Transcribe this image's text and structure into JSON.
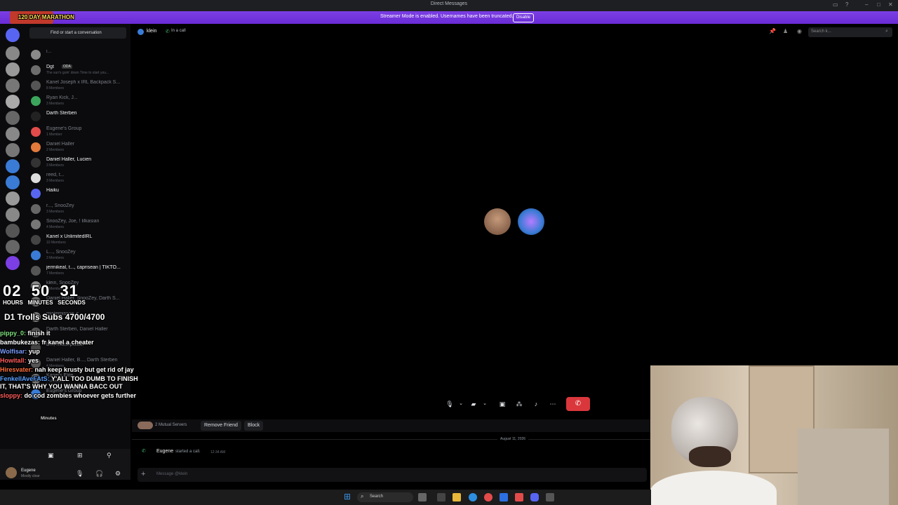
{
  "window": {
    "title": "Direct Messages"
  },
  "banner": {
    "message": "Streamer Mode is enabled. Usernames have been truncated.",
    "button": "Disable"
  },
  "dm_search": {
    "placeholder": "Find or start a conversation"
  },
  "dms": [
    {
      "name": "i...",
      "sub": "",
      "color": "#8a8a8a"
    },
    {
      "name": "Dgt",
      "tag": "ODA",
      "sub": "The sun's goin' down Time to start you...",
      "color": "#6d6d6d",
      "highlight": true
    },
    {
      "name": "Kanel Joseph x IRL Backpack S...",
      "sub": "8 Members",
      "color": "#555"
    },
    {
      "name": "Ryan Kick, J...",
      "sub": "3 Members",
      "color": "#3ba55c"
    },
    {
      "name": "Darth Sterben",
      "sub": "",
      "color": "#222",
      "highlight": true
    },
    {
      "name": "Eugene's Group",
      "sub": "1 Member",
      "color": "#e34b4b"
    },
    {
      "name": "Daniel Haller",
      "sub": "2 Members",
      "color": "#e3793b"
    },
    {
      "name": "Daniel Haller, Lucien",
      "sub": "3 Members",
      "color": "#333",
      "highlight": true
    },
    {
      "name": "reed, t...",
      "sub": "3 Members",
      "color": "#ddd"
    },
    {
      "name": "Haiku",
      "sub": "",
      "color": "#5865f2",
      "highlight": true
    },
    {
      "name": "r..., SnooZey",
      "sub": "3 Members",
      "color": "#666"
    },
    {
      "name": "SnooZey, Joe, ! lilkasian",
      "sub": "4 Members",
      "color": "#777"
    },
    {
      "name": "Kanel x UnlimitedIRL",
      "sub": "10 Members",
      "color": "#444",
      "highlight": true
    },
    {
      "name": "L..., SnooZey",
      "sub": "3 Members",
      "color": "#3a7bd5"
    },
    {
      "name": "jermikeal, t..., caprisean | TIKTO...",
      "sub": "7 Members",
      "color": "#555",
      "highlight": true
    },
    {
      "name": "klein, SnooZey",
      "sub": "3 Members",
      "color": "#888"
    },
    {
      "name": "Daniel Haller, SnooZey, Darth S...",
      "sub": "",
      "color": "#666"
    },
    {
      "name": "misterpissair, s...",
      "sub": "",
      "color": "#777"
    },
    {
      "name": "Darth Sterben, Daniel Haller",
      "sub": "",
      "color": "#555"
    },
    {
      "name": "B..., misterpissair",
      "sub": "",
      "color": "#444"
    },
    {
      "name": "Daniel Haller, B..., Darth Sterben",
      "sub": "4 Members",
      "color": "#555"
    },
    {
      "name": "Kanel's Elite",
      "sub": "7 Members",
      "color": "#777"
    },
    {
      "name": "Eugene's Group",
      "sub": "",
      "color": "#3a7bd5"
    }
  ],
  "overlay": {
    "marathon": "120 DAY MARATHON",
    "timer": {
      "hours": "02",
      "minutes": "50",
      "seconds": "31",
      "h_label": "HOURS",
      "m_label": "MINUTES",
      "s_label": "SECONDS"
    },
    "subs": "D1 Trolls Subs 4700/4700",
    "chat": [
      {
        "user": "pippy_0:",
        "text": "finish it",
        "color": "#7ee07e"
      },
      {
        "user": "bambukezas:",
        "text": "fr kanel a cheater",
        "color": "#fff"
      },
      {
        "user": "Wolfisar:",
        "text": "yup",
        "color": "#7b9cff"
      },
      {
        "user": "Howitall:",
        "text": "yes",
        "color": "#ff5c5c"
      },
      {
        "user": "Hiresvater:",
        "text": "nah keep krusty but get rid of jay",
        "color": "#ff6f3c"
      },
      {
        "user": "FenkellAveFAtS:",
        "text": "Y'ALL TOO DUMB TO FINISH IT, THAT'S WHY YOU WANNA BACC OUT",
        "color": "#5aa0ff"
      },
      {
        "user": "sloppy:",
        "text": "do cod zombies whoever gets further",
        "color": "#ff5c5c"
      }
    ],
    "clock_label": "Minutes"
  },
  "call": {
    "name": "klein",
    "status": "In a call",
    "search_placeholder": "Search k..."
  },
  "profile_bar": {
    "mutual": "2 Mutual Servers",
    "remove": "Remove Friend",
    "block": "Block"
  },
  "messages": {
    "date": "August 11, 2026",
    "items": [
      {
        "user": "Eugene",
        "text": "started a call.",
        "time": "12:34 AM"
      }
    ]
  },
  "composer": {
    "placeholder": "Message @klein"
  },
  "user_panel": {
    "name": "Eugene",
    "status": "Mostly clear"
  },
  "taskbar": {
    "search": "Search"
  }
}
